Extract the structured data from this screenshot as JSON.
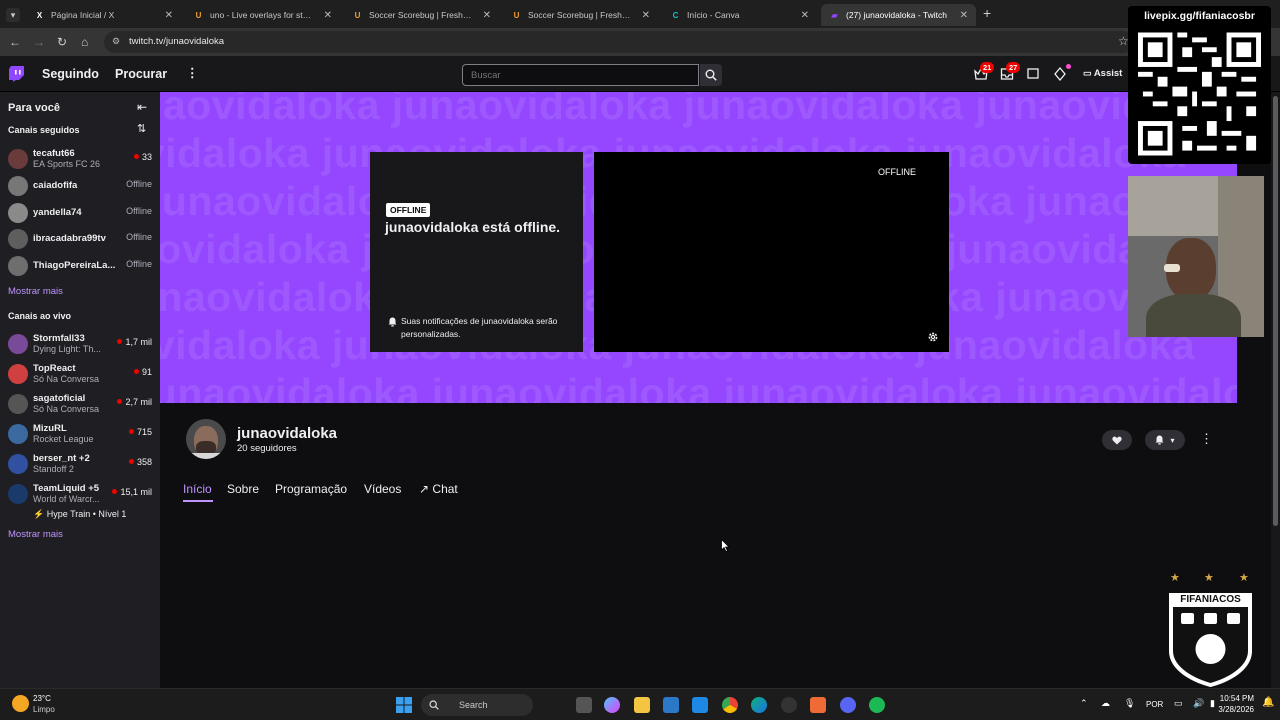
{
  "browser": {
    "tabs": [
      {
        "title": "Página Inicial / X",
        "icon": "x-logo-icon",
        "color": "#ffffff"
      },
      {
        "title": "uno - Live overlays for streamin",
        "icon": "uno-logo-icon",
        "color": "#f0a030"
      },
      {
        "title": "Soccer Scorebug | Fresh - overl",
        "icon": "uno-logo-icon",
        "color": "#f0a030"
      },
      {
        "title": "Soccer Scorebug | Fresh - overl",
        "icon": "uno-logo-icon",
        "color": "#f0a030"
      },
      {
        "title": "Início - Canva",
        "icon": "canva-logo-icon",
        "color": "#00c4cc"
      },
      {
        "title": "(27) junaovidaloka - Twitch",
        "icon": "twitch-logo-icon",
        "color": "#9146ff"
      }
    ],
    "url": "twitch.tv/junaovidaloka"
  },
  "twitch_nav": {
    "following": "Seguindo",
    "browse": "Procurar",
    "search_placeholder": "Buscar",
    "badge_inbox": "21",
    "badge_notifications": "27",
    "assist_label": "Assist"
  },
  "sidebar": {
    "for_you": "Para você",
    "followed_title": "Canais seguidos",
    "followed": [
      {
        "name": "tecafut66",
        "game": "EA Sports FC 26",
        "status": "33",
        "live": true,
        "color": "#6a3b3b"
      },
      {
        "name": "caiadofifa",
        "game": "",
        "status": "Offline",
        "live": false,
        "color": "#777777"
      },
      {
        "name": "yandella74",
        "game": "",
        "status": "Offline",
        "live": false,
        "color": "#8a8a8a"
      },
      {
        "name": "ibracadabra99tv",
        "game": "",
        "status": "Offline",
        "live": false,
        "color": "#5e5e5e"
      },
      {
        "name": "ThiagoPereiraLa...",
        "game": "",
        "status": "Offline",
        "live": false,
        "color": "#6e6e6e"
      }
    ],
    "show_more_1": "Mostrar mais",
    "live_title": "Canais ao vivo",
    "live": [
      {
        "name": "Stormfall33",
        "game": "Dying Light: Th...",
        "status": "1,7 mil",
        "color": "#7a4a9a"
      },
      {
        "name": "TopReact",
        "game": "Só Na Conversa",
        "status": "91",
        "color": "#d04040"
      },
      {
        "name": "sagatoficial",
        "game": "Só Na Conversa",
        "status": "2,7 mil",
        "color": "#555555"
      },
      {
        "name": "MizuRL",
        "game": "Rocket League",
        "status": "715",
        "color": "#3a6aa0"
      },
      {
        "name": "berser_nt +2",
        "game": "Standoff 2",
        "status": "358",
        "color": "#3050a0"
      },
      {
        "name": "TeamLiquid +5",
        "game": "World of Warcr...",
        "status": "15,1 mil",
        "color": "#1a3a6a"
      }
    ],
    "hype_train": "Hype Train • Nível 1",
    "show_more_2": "Mostrar mais"
  },
  "banner": {
    "watermark": "junaovidaloka junaovidaloka junaovidaloka junaovidaloka",
    "offline_badge": "OFFLINE",
    "offline_title": "junaovidaloka está offline.",
    "notification_text": "Suas notificações de junaovidaloka serão personalizadas.",
    "player_label": "OFFLINE"
  },
  "channel": {
    "name": "junaovidaloka",
    "followers": "20 seguidores",
    "tabs": [
      "Início",
      "Sobre",
      "Programação",
      "Vídeos",
      "Chat"
    ]
  },
  "overlay": {
    "qr_title": "livepix.gg/fifaniacosbr",
    "badge_title": "FIFANIACOS"
  },
  "taskbar": {
    "temp": "23°C",
    "weather": "Limpo",
    "search": "Search",
    "lang": "POR",
    "time": "10:54 PM",
    "date": "3/28/2026"
  }
}
